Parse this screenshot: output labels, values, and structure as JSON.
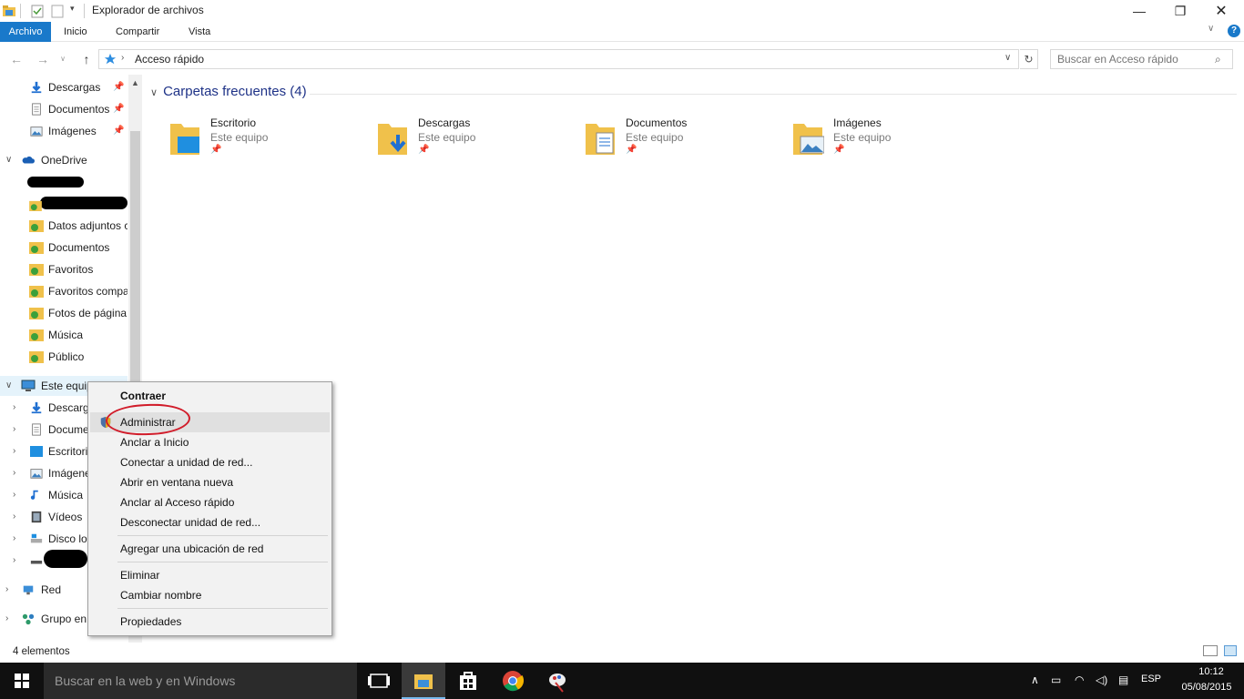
{
  "window": {
    "title": "Explorador de archivos"
  },
  "ribbon": {
    "tabs": [
      "Archivo",
      "Inicio",
      "Compartir",
      "Vista"
    ]
  },
  "address": {
    "path": "Acceso rápido",
    "search_placeholder": "Buscar en Acceso rápido"
  },
  "nav": {
    "quick_access": [
      {
        "label": "Descargas",
        "pinned": true
      },
      {
        "label": "Documentos",
        "pinned": true
      },
      {
        "label": "Imágenes",
        "pinned": true
      }
    ],
    "onedrive": {
      "label": "OneDrive",
      "items": [
        "Datos adjuntos c",
        "Documentos",
        "Favoritos",
        "Favoritos compa",
        "Fotos de página",
        "Música",
        "Público"
      ]
    },
    "this_pc": {
      "label": "Este equip",
      "items": [
        "Descarg",
        "Docume",
        "Escritori",
        "Imágene",
        "Música",
        "Vídeos",
        "Disco lo"
      ]
    },
    "network": "Red",
    "homegroup": "Grupo en"
  },
  "main": {
    "group_title": "Carpetas frecuentes (4)",
    "folders": [
      {
        "name": "Escritorio",
        "location": "Este equipo"
      },
      {
        "name": "Descargas",
        "location": "Este equipo"
      },
      {
        "name": "Documentos",
        "location": "Este equipo"
      },
      {
        "name": "Imágenes",
        "location": "Este equipo"
      }
    ]
  },
  "status": {
    "count": "4 elementos"
  },
  "context_menu": {
    "items": [
      {
        "label": "Contraer",
        "bold": true
      },
      {
        "label": "Administrar",
        "highlighted": true,
        "shield": true
      },
      {
        "label": "Anclar a Inicio"
      },
      {
        "label": "Conectar a unidad de red..."
      },
      {
        "label": "Abrir en ventana nueva"
      },
      {
        "label": "Anclar al Acceso rápido"
      },
      {
        "label": "Desconectar unidad de red..."
      },
      {
        "label": "Agregar una ubicación de red"
      },
      {
        "label": "Eliminar"
      },
      {
        "label": "Cambiar nombre"
      },
      {
        "label": "Propiedades"
      }
    ]
  },
  "taskbar": {
    "search_placeholder": "Buscar en la web y en Windows",
    "language": "ESP",
    "time": "10:12",
    "date": "05/08/2015"
  },
  "colors": {
    "accent": "#1979ca",
    "folder": "#f0c14b",
    "highlight_ring": "#d11c2a",
    "taskbar": "#101010"
  }
}
